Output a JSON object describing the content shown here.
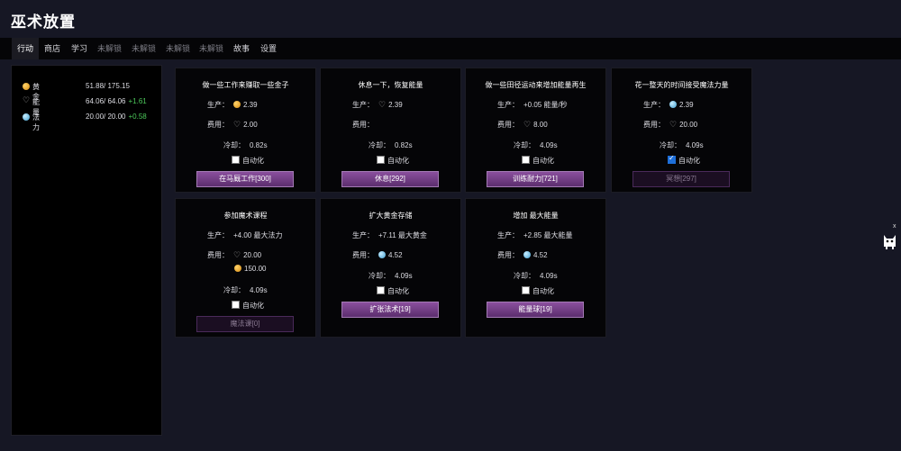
{
  "app": {
    "title": "巫术放置"
  },
  "tabs": [
    {
      "label": "行动"
    },
    {
      "label": "商店"
    },
    {
      "label": "学习"
    },
    {
      "label": "未解锁"
    },
    {
      "label": "未解锁"
    },
    {
      "label": "未解锁"
    },
    {
      "label": "未解锁"
    },
    {
      "label": "故事"
    },
    {
      "label": "设置"
    }
  ],
  "resources": [
    {
      "name": "黄金",
      "value": "51.88/ 175.15",
      "rate": ""
    },
    {
      "name": "能量",
      "value": "64.06/ 64.06",
      "rate": "+1.61"
    },
    {
      "name": "法力",
      "value": "20.00/ 20.00",
      "rate": "+0.58"
    }
  ],
  "labels": {
    "produce": "生产：",
    "cost": "费用：",
    "cooldown": "冷却：",
    "auto": "自动化"
  },
  "cards": [
    {
      "title": "做一些工作来赚取一些金子",
      "produce": "2.39",
      "cost": "2.00",
      "cooldown": "0.82s",
      "button": "在马厩工作[300]"
    },
    {
      "title": "休息一下，恢复能量",
      "produce": "2.39",
      "cost": "",
      "cooldown": "0.82s",
      "button": "休息[292]"
    },
    {
      "title": "做一些田径运动来增加能量再生",
      "produce": "+0.05 能量/秒",
      "cost": "8.00",
      "cooldown": "4.09s",
      "button": "训练耐力[721]"
    },
    {
      "title": "花一整天的时间接受魔法力量",
      "produce": "2.39",
      "cost": "20.00",
      "cooldown": "4.09s",
      "button": "冥想[297]"
    },
    {
      "title": "参加魔术课程",
      "produce": "+4.00 最大法力",
      "cost": "20.00",
      "cost2": "150.00",
      "cooldown": "4.09s",
      "button": "魔法课[0]"
    },
    {
      "title": "扩大黄金存储",
      "produce": "+7.11 最大黄金",
      "cost": "4.52",
      "cooldown": "4.09s",
      "button": "扩张法术[19]"
    },
    {
      "title": "增加 最大能量",
      "produce": "+2.85 最大能量",
      "cost": "4.52",
      "cooldown": "4.09s",
      "button": "能量球[19]"
    }
  ],
  "widget": {
    "close": "x"
  },
  "colors": {
    "background": "#161724",
    "panel": "#050507",
    "button": "#8a4f9d",
    "rate_positive": "#4cc85a"
  }
}
